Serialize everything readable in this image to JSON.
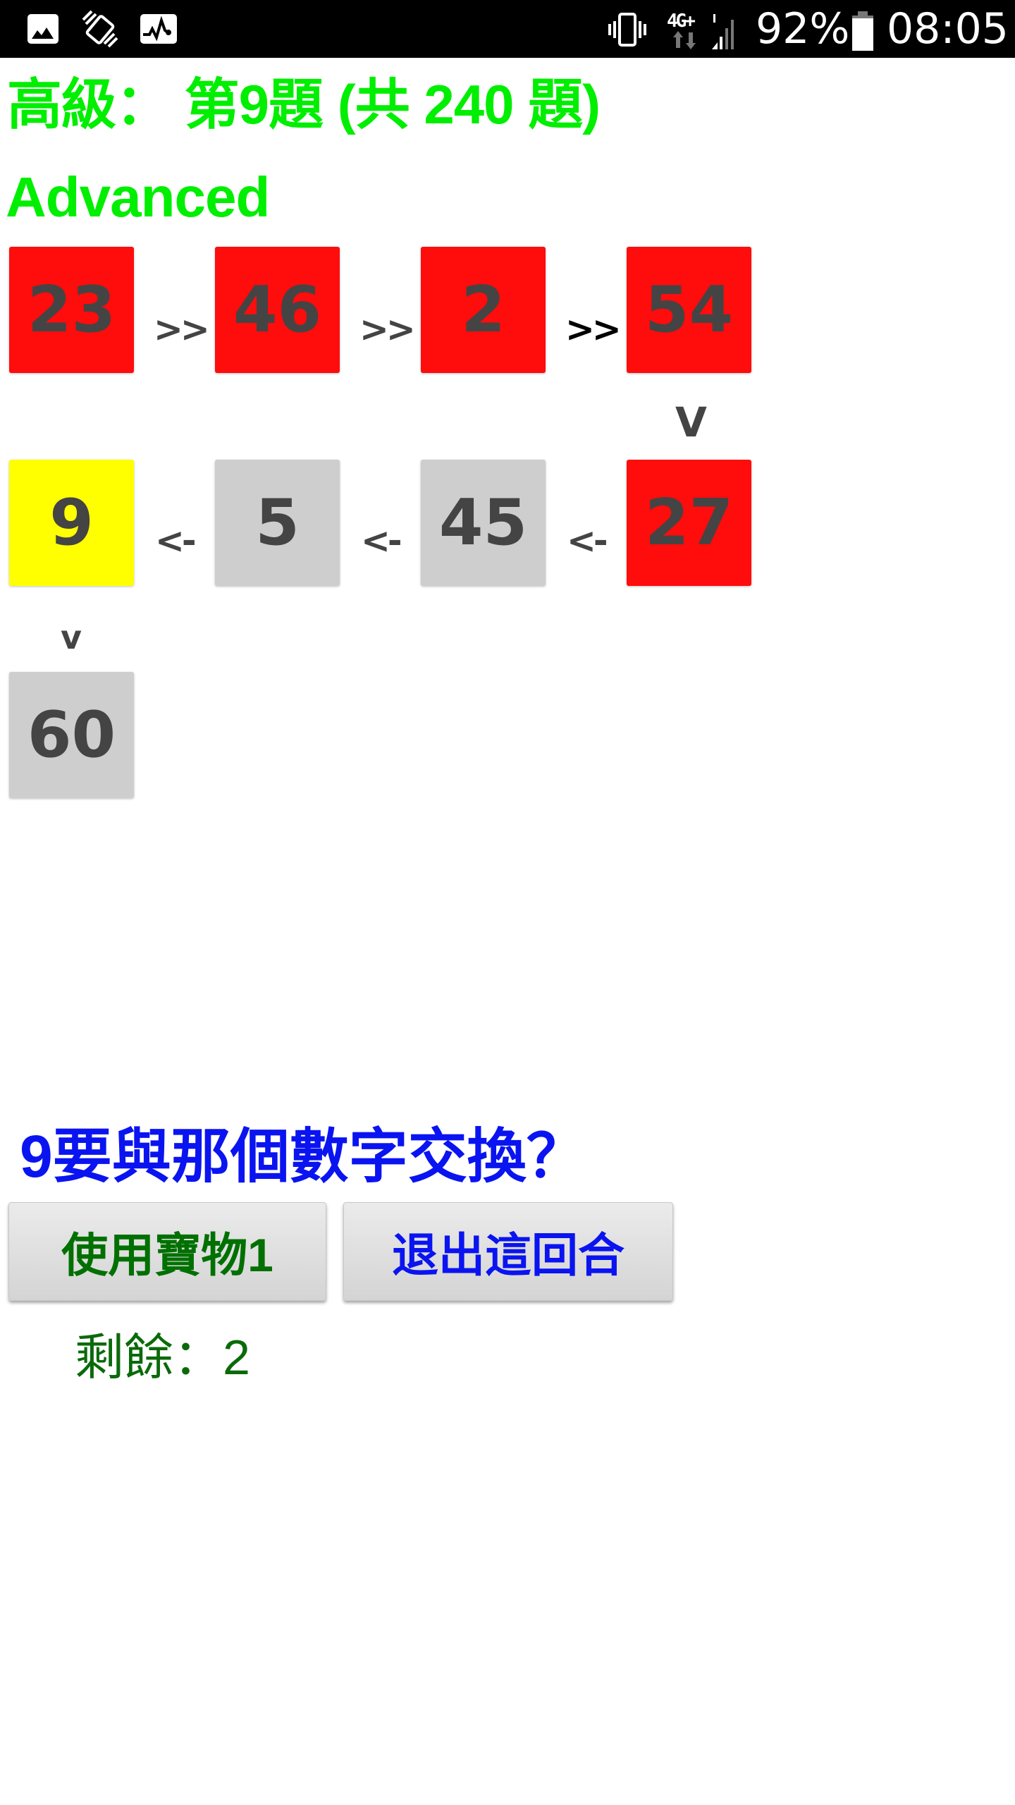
{
  "status_bar": {
    "left_icons": [
      "gallery-icon",
      "auto-rotate-icon",
      "activity-monitor-icon"
    ],
    "right_icons": [
      "vibrate-icon",
      "network-4g-plus-icon",
      "signal-strength-icon",
      "battery-icon"
    ],
    "network_label": "4G+",
    "battery_percent": "92%",
    "time": "08:05"
  },
  "header": {
    "title": "高級： 第9題 (共 240 題)",
    "level_label": "高級",
    "question_number": 9,
    "total_questions": 240,
    "subtitle": "Advanced"
  },
  "board": {
    "row1": {
      "cells": [
        {
          "value": "23",
          "state": "red"
        },
        {
          "value": "46",
          "state": "red"
        },
        {
          "value": "2",
          "state": "red"
        },
        {
          "value": "54",
          "state": "red"
        }
      ],
      "connectors": [
        {
          "text": ">>",
          "style": "normal"
        },
        {
          "text": ">>",
          "style": "normal"
        },
        {
          "text": ">>",
          "style": "dark"
        }
      ]
    },
    "turn_down_1": "V",
    "row2": {
      "cells": [
        {
          "value": "9",
          "state": "yellow"
        },
        {
          "value": "5",
          "state": "gray"
        },
        {
          "value": "45",
          "state": "gray"
        },
        {
          "value": "27",
          "state": "red"
        }
      ],
      "connectors": [
        {
          "text": "<-"
        },
        {
          "text": "<-"
        },
        {
          "text": "<-"
        }
      ]
    },
    "turn_down_2": "v",
    "row3": {
      "cells": [
        {
          "value": "60",
          "state": "gray"
        }
      ]
    }
  },
  "prompt": {
    "question": "9要與那個數字交換？"
  },
  "actions": {
    "use_treasure_label": "使用寶物1",
    "exit_round_label": "退出這回合"
  },
  "remaining": {
    "text": "剩餘：2",
    "count": 2
  },
  "colors": {
    "title_green": "#00ee00",
    "cell_red": "#ff0c0c",
    "cell_yellow": "#ffff00",
    "cell_gray": "#cecece",
    "digit": "#444444",
    "question_blue": "#0a14f0",
    "use_button_text": "#007000",
    "remaining_text": "#0a6a0a"
  }
}
